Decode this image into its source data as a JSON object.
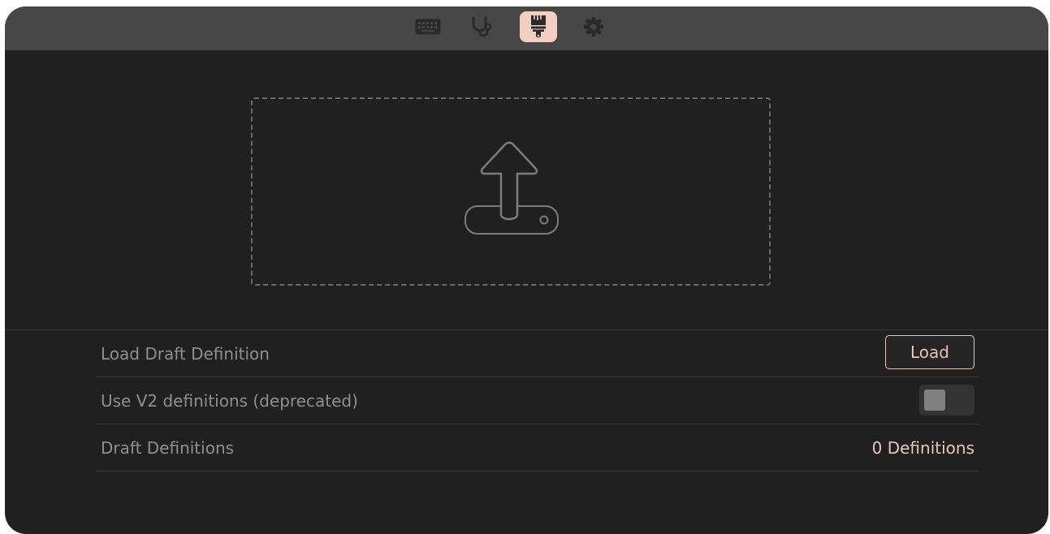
{
  "tabs": [
    {
      "icon": "keyboard-icon",
      "active": false
    },
    {
      "icon": "stethoscope-icon",
      "active": false
    },
    {
      "icon": "paint-brush-icon",
      "active": true
    },
    {
      "icon": "gear-icon",
      "active": false
    }
  ],
  "dropzone": {
    "icon": "upload-icon"
  },
  "settings": {
    "load_draft": {
      "label": "Load Draft Definition",
      "button_label": "Load"
    },
    "use_v2": {
      "label": "Use V2 definitions (deprecated)",
      "enabled": false
    },
    "draft_definitions": {
      "label": "Draft Definitions",
      "value": "0 Definitions"
    }
  },
  "colors": {
    "accent": "#f3cfc2",
    "background": "#202020",
    "tabbar": "#474747",
    "label": "#8f8f8f"
  }
}
